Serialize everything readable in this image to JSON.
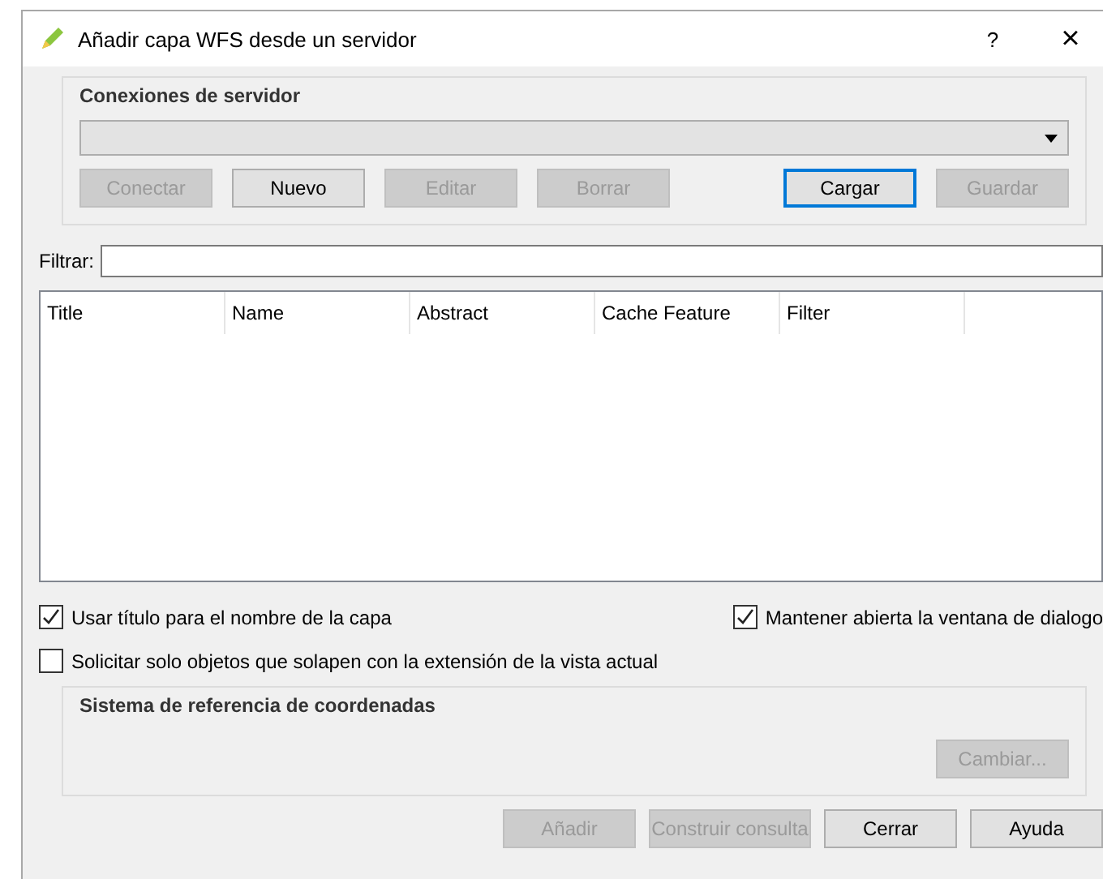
{
  "window": {
    "title": "Añadir capa WFS desde un servidor",
    "help": "?",
    "close": "×"
  },
  "connections": {
    "title": "Conexiones de servidor",
    "buttons": [
      {
        "label": "Conectar",
        "disabled": true,
        "focused": false
      },
      {
        "label": "Nuevo",
        "disabled": false,
        "focused": false
      },
      {
        "label": "Editar",
        "disabled": true,
        "focused": false
      },
      {
        "label": "Borrar",
        "disabled": true,
        "focused": false
      },
      {
        "label": "Cargar",
        "disabled": false,
        "focused": true
      },
      {
        "label": "Guardar",
        "disabled": true,
        "focused": false
      }
    ]
  },
  "filter": {
    "label": "Filtrar:"
  },
  "table": {
    "columns": [
      "Title",
      "Name",
      "Abstract",
      "Cache Feature",
      "Filter"
    ]
  },
  "options": [
    {
      "label": "Usar título para el nombre de la capa",
      "checked": true
    },
    {
      "label": "Mantener abierta la ventana de dialogo",
      "checked": true
    },
    {
      "label": "Solicitar solo objetos que solapen con la extensión de la vista actual",
      "checked": false
    }
  ],
  "crs": {
    "title": "Sistema de referencia de coordenadas",
    "button": {
      "label": "Cambiar...",
      "disabled": true
    }
  },
  "buttons": [
    {
      "label": "Añadir",
      "disabled": true
    },
    {
      "label": "Construir consulta",
      "disabled": true
    },
    {
      "label": "Cerrar",
      "disabled": false
    },
    {
      "label": "Ayuda",
      "disabled": false
    }
  ]
}
